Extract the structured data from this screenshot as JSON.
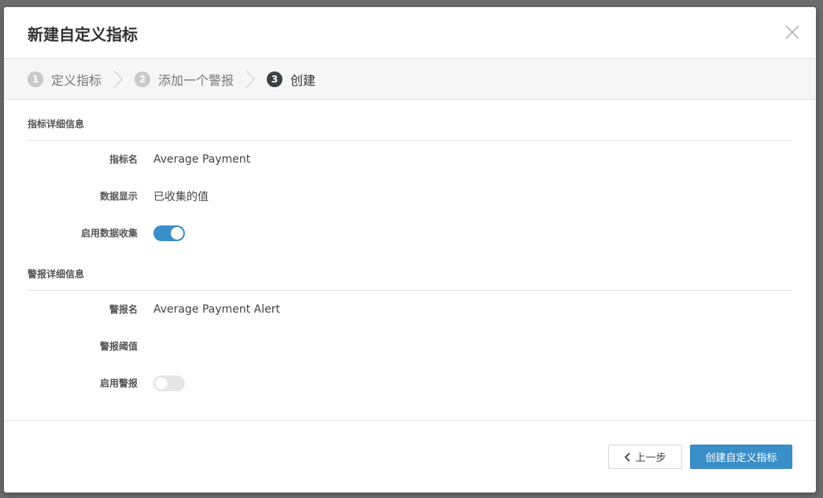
{
  "modal": {
    "title": "新建自定义指标",
    "close_icon": "close-icon"
  },
  "wizard": {
    "steps": [
      {
        "num": "1",
        "label": "定义指标",
        "active": false
      },
      {
        "num": "2",
        "label": "添加一个警报",
        "active": false
      },
      {
        "num": "3",
        "label": "创建",
        "active": true
      }
    ]
  },
  "metric_section": {
    "title": "指标详细信息",
    "name_label": "指标名",
    "name_value": "Average Payment",
    "display_label": "数据显示",
    "display_value": "已收集的值",
    "collect_label": "启用数据收集",
    "collect_enabled": true
  },
  "alert_section": {
    "title": "警报详细信息",
    "name_label": "警报名",
    "name_value": "Average Payment Alert",
    "threshold_label": "警报阈值",
    "threshold_value": "",
    "enable_label": "启用警报",
    "enable_enabled": false
  },
  "footer": {
    "prev_label": "上一步",
    "create_label": "创建自定义指标"
  },
  "colors": {
    "accent": "#3b8fc8",
    "step_active": "#3c4147",
    "step_inactive": "#c9c9c9"
  }
}
